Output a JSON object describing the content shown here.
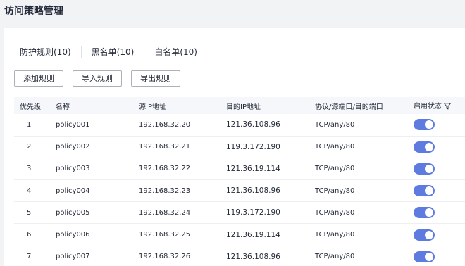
{
  "page": {
    "title": "访问策略管理"
  },
  "tabs": [
    {
      "label": "防护规则(10)"
    },
    {
      "label": "黑名单(10)"
    },
    {
      "label": "白名单(10)"
    }
  ],
  "toolbar": {
    "add_label": "添加规则",
    "import_label": "导入规则",
    "export_label": "导出规则"
  },
  "table": {
    "headers": {
      "priority": "优先级",
      "name": "名称",
      "src_ip": "源IP地址",
      "dst_ip": "目的IP地址",
      "protocol": "协议/源端口/目的端口",
      "status": "启用状态"
    },
    "rows": [
      {
        "priority": "1",
        "name": "policy001",
        "src_ip": "192.168.32.20",
        "dst_ip": "121.36.108.96",
        "protocol": "TCP/any/80",
        "enabled": true
      },
      {
        "priority": "2",
        "name": "policy002",
        "src_ip": "192.168.32.21",
        "dst_ip": "119.3.172.190",
        "protocol": "TCP/any/80",
        "enabled": true
      },
      {
        "priority": "3",
        "name": "policy003",
        "src_ip": "192.168.32.22",
        "dst_ip": "121.36.19.114",
        "protocol": "TCP/any/80",
        "enabled": true
      },
      {
        "priority": "4",
        "name": "policy004",
        "src_ip": "192.168.32.23",
        "dst_ip": "121.36.108.96",
        "protocol": "TCP/any/80",
        "enabled": true
      },
      {
        "priority": "5",
        "name": "policy005",
        "src_ip": "192.168.32.24",
        "dst_ip": "119.3.172.190",
        "protocol": "TCP/any/80",
        "enabled": true
      },
      {
        "priority": "6",
        "name": "policy006",
        "src_ip": "192.168.32.25",
        "dst_ip": "121.36.19.114",
        "protocol": "TCP/any/80",
        "enabled": true
      },
      {
        "priority": "7",
        "name": "policy007",
        "src_ip": "192.168.32.26",
        "dst_ip": "121.36.108.96",
        "protocol": "TCP/any/80",
        "enabled": true
      }
    ]
  },
  "colors": {
    "toggle_on": "#5e7ce0",
    "header_bg": "#f5f7fa",
    "page_bg": "#f2f3f5"
  },
  "icons": {
    "status_filter": "filter-icon"
  }
}
